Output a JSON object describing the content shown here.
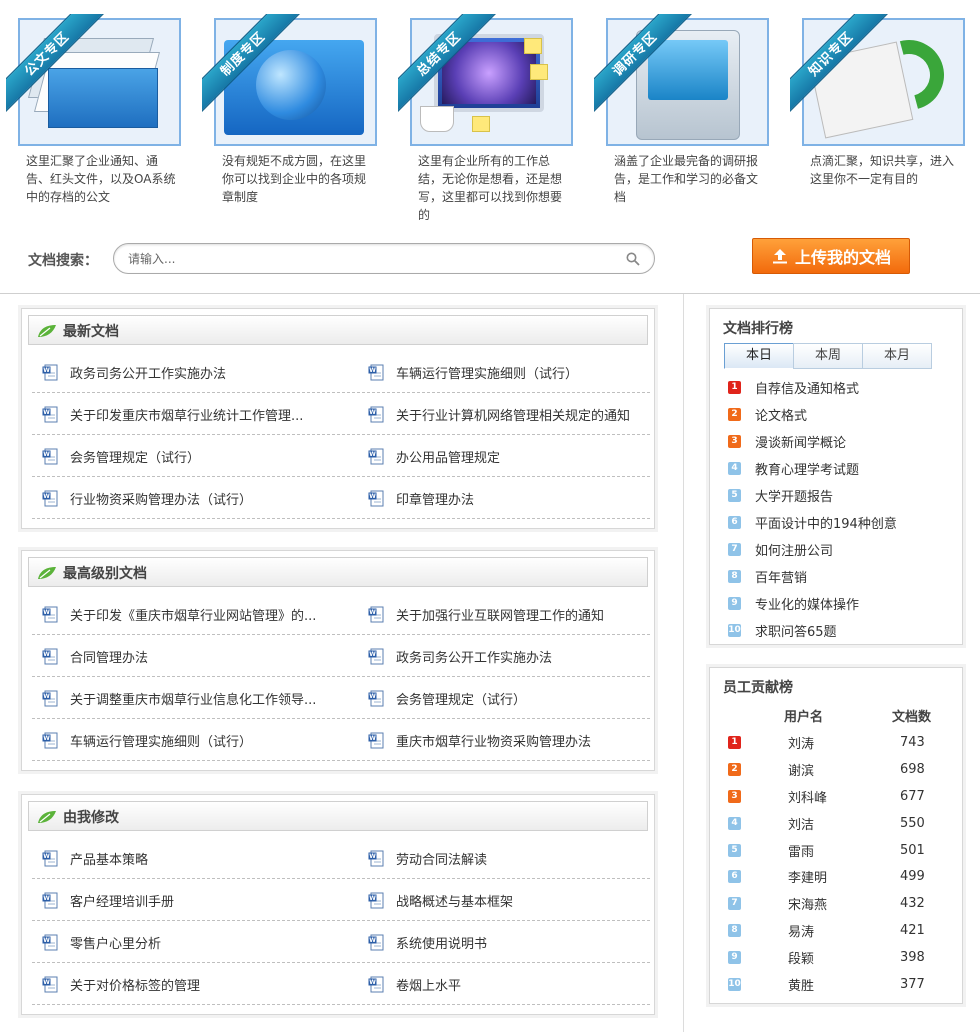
{
  "zones": [
    {
      "ribbon": "公文专区",
      "description": "这里汇聚了企业通知、通告、红头文件，以及OA系统中的存档的公文",
      "icon": "document-stack-icon"
    },
    {
      "ribbon": "制度专区",
      "description": "没有规矩不成方圆，在这里你可以找到企业中的各项规章制度",
      "icon": "globe-monitor-icon"
    },
    {
      "ribbon": "总结专区",
      "description": "这里有企业所有的工作总结，无论你是想看，还是想写，这里都可以找到你想要的",
      "icon": "monitor-notes-icon"
    },
    {
      "ribbon": "调研专区",
      "description": "涵盖了企业最完备的调研报告，是工作和学习的必备文档",
      "icon": "device-icon"
    },
    {
      "ribbon": "知识专区",
      "description": "点滴汇聚，知识共享，进入这里你不一定有目的",
      "icon": "newspaper-arrow-icon"
    }
  ],
  "search": {
    "label": "文档搜索：",
    "placeholder": "请输入..."
  },
  "upload": {
    "label": "上传我的文档"
  },
  "panels": [
    {
      "title": "最新文档",
      "rows": [
        [
          "政务司务公开工作实施办法",
          "车辆运行管理实施细则（试行）"
        ],
        [
          "关于印发重庆市烟草行业统计工作管理...",
          "关于行业计算机网络管理相关规定的通知"
        ],
        [
          "会务管理规定（试行）",
          "办公用品管理规定"
        ],
        [
          "行业物资采购管理办法（试行）",
          "印章管理办法"
        ]
      ]
    },
    {
      "title": "最高级别文档",
      "rows": [
        [
          "关于印发《重庆市烟草行业网站管理》的...",
          "关于加强行业互联网管理工作的通知"
        ],
        [
          "合同管理办法",
          "政务司务公开工作实施办法"
        ],
        [
          "关于调整重庆市烟草行业信息化工作领导...",
          "会务管理规定（试行）"
        ],
        [
          "车辆运行管理实施细则（试行）",
          "重庆市烟草行业物资采购管理办法"
        ]
      ]
    },
    {
      "title": "由我修改",
      "rows": [
        [
          "产品基本策略",
          "劳动合同法解读"
        ],
        [
          "客户经理培训手册",
          "战略概述与基本框架"
        ],
        [
          "零售户心里分析",
          "系统使用说明书"
        ],
        [
          "关于对价格标签的管理",
          "卷烟上水平"
        ]
      ]
    }
  ],
  "ranking": {
    "title": "文档排行榜",
    "tabs": [
      "本日",
      "本周",
      "本月"
    ],
    "active_tab": 0,
    "items": [
      {
        "rank": "1",
        "label": "自荐信及通知格式"
      },
      {
        "rank": "2",
        "label": "论文格式"
      },
      {
        "rank": "3",
        "label": "漫谈新闻学概论"
      },
      {
        "rank": "4",
        "label": "教育心理学考试题"
      },
      {
        "rank": "5",
        "label": "大学开题报告"
      },
      {
        "rank": "6",
        "label": "平面设计中的194种创意"
      },
      {
        "rank": "7",
        "label": "如何注册公司"
      },
      {
        "rank": "8",
        "label": "百年营销"
      },
      {
        "rank": "9",
        "label": "专业化的媒体操作"
      },
      {
        "rank": "10",
        "label": "求职问答65题"
      }
    ]
  },
  "contributors": {
    "title": "员工贡献榜",
    "col_user": "用户名",
    "col_count": "文档数",
    "rows": [
      {
        "rank": "1",
        "name": "刘涛",
        "count": "743"
      },
      {
        "rank": "2",
        "name": "谢滨",
        "count": "698"
      },
      {
        "rank": "3",
        "name": "刘科峰",
        "count": "677"
      },
      {
        "rank": "4",
        "name": "刘洁",
        "count": "550"
      },
      {
        "rank": "5",
        "name": "雷雨",
        "count": "501"
      },
      {
        "rank": "6",
        "name": "李建明",
        "count": "499"
      },
      {
        "rank": "7",
        "name": "宋海燕",
        "count": "432"
      },
      {
        "rank": "8",
        "name": "易涛",
        "count": "421"
      },
      {
        "rank": "9",
        "name": "段颖",
        "count": "398"
      },
      {
        "rank": "10",
        "name": "黄胜",
        "count": "377"
      }
    ]
  },
  "colors": {
    "rank_top": [
      "#e0241b",
      "#f06a1a",
      "#f06a1a"
    ],
    "rank_other": "#8fc3e8",
    "upload_button": "#f47a12",
    "ribbon": "#1f8fbf"
  }
}
